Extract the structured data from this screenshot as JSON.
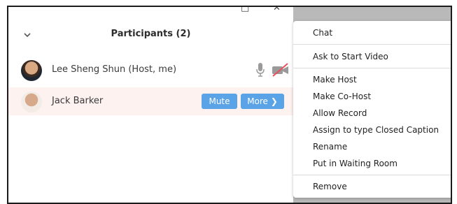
{
  "window": {
    "restore_glyph": "□",
    "close_glyph": "✕"
  },
  "header": {
    "title": "Participants (2)",
    "collapse_icon": "chevron-down-icon"
  },
  "participants": [
    {
      "name": "Lee Sheng Shun (Host, me)",
      "avatar": "avatar-photo",
      "mic_icon": "microphone-icon",
      "video_icon": "video-off-icon"
    },
    {
      "name": "Jack Barker",
      "avatar": "avatar-photo",
      "highlighted": true
    }
  ],
  "row_actions": {
    "mute_label": "Mute",
    "more_label": "More ❯"
  },
  "context_menu": {
    "items": [
      "Chat",
      "Ask to Start Video",
      "Make Host",
      "Make Co-Host",
      "Allow Record",
      "Assign to type Closed Caption",
      "Rename",
      "Put in Waiting Room",
      "Remove"
    ]
  },
  "colors": {
    "accent_button": "#5ba3e7",
    "row_highlight": "#fdf2ef",
    "video_off_red": "#e8505b",
    "backdrop_gray": "#b9b9b9"
  }
}
